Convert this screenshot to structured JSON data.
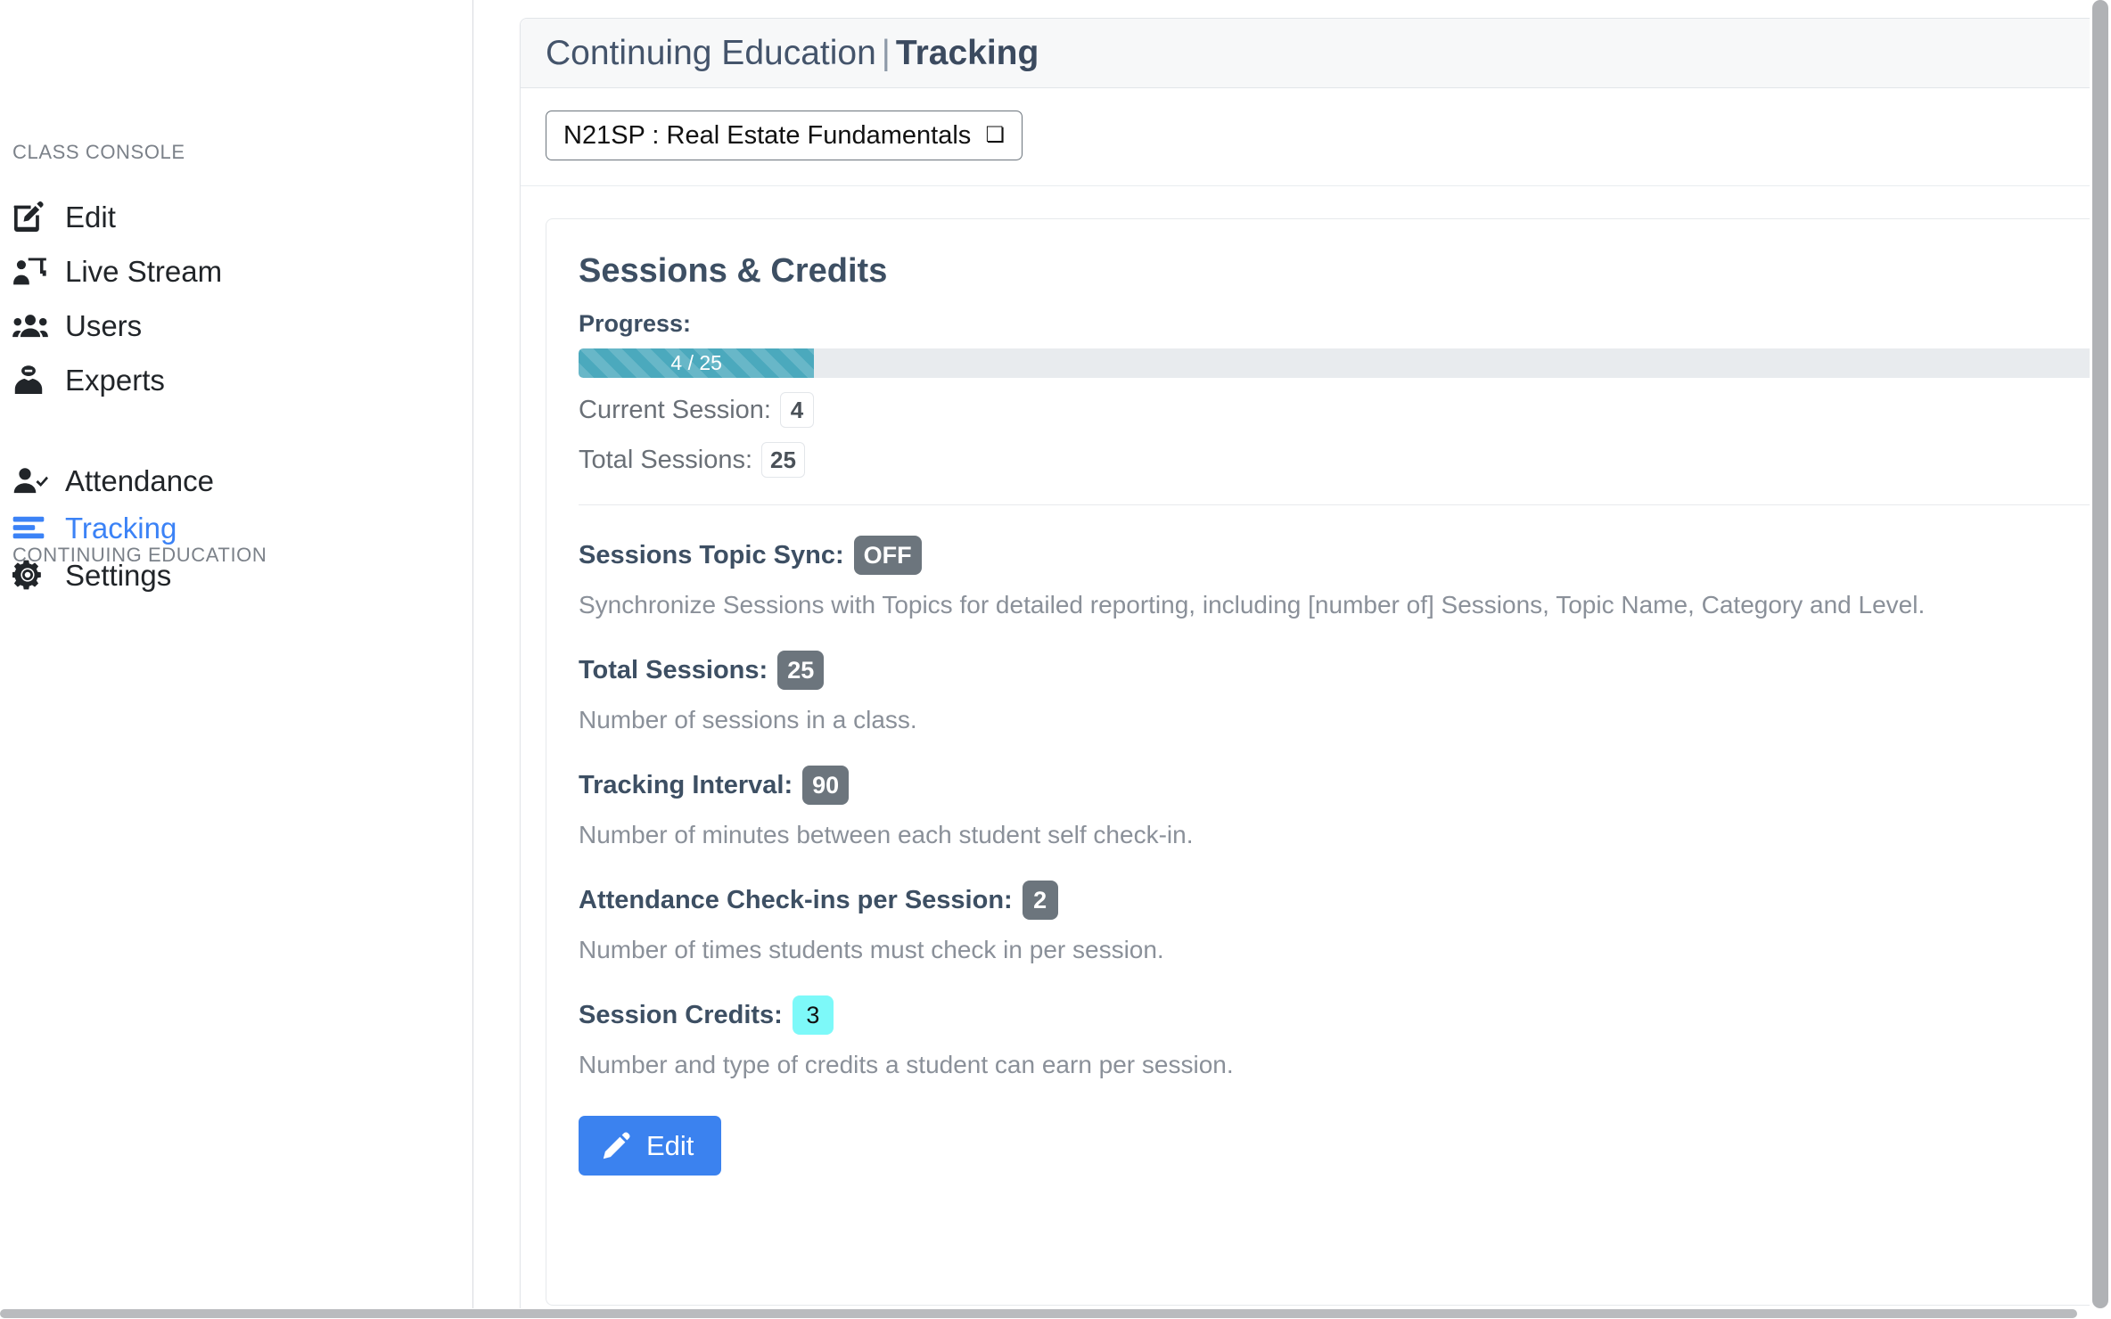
{
  "sidebar": {
    "sections": [
      {
        "label": "CLASS CONSOLE"
      },
      {
        "label": "CONTINUING EDUCATION"
      }
    ],
    "items": [
      {
        "label": "Edit",
        "icon": "edit-square-icon",
        "active": false
      },
      {
        "label": "Live Stream",
        "icon": "chalkboard-user-icon",
        "active": false
      },
      {
        "label": "Users",
        "icon": "users-group-icon",
        "active": false
      },
      {
        "label": "Experts",
        "icon": "user-tie-icon",
        "active": false
      },
      {
        "label": "Attendance",
        "icon": "user-check-icon",
        "active": false
      },
      {
        "label": "Tracking",
        "icon": "align-left-bars-icon",
        "active": true
      },
      {
        "label": "Settings",
        "icon": "gear-icon",
        "active": false
      }
    ],
    "active_color": "#3b82f6"
  },
  "header": {
    "breadcrumb_primary": "Continuing Education",
    "breadcrumb_separator": "|",
    "breadcrumb_current": "Tracking"
  },
  "class_selector": {
    "selected": "N21SP : Real Estate Fundamentals",
    "caret": "chevron-down-icon",
    "options": [
      "N21SP : Real Estate Fundamentals"
    ]
  },
  "panel": {
    "title": "Sessions & Credits",
    "progress": {
      "label": "Progress:",
      "text": "4 / 25",
      "current": 4,
      "total": 25,
      "percent": 16,
      "fill_color": "#4ba9bd",
      "track_color": "#e8ebee"
    },
    "summary": [
      {
        "label": "Current Session:",
        "value": "4"
      },
      {
        "label": "Total Sessions:",
        "value": "25"
      }
    ],
    "settings": [
      {
        "label": "Sessions Topic Sync:",
        "value": "OFF",
        "highlight": false,
        "description": "Synchronize Sessions with Topics for detailed reporting, including [number of] Sessions, Topic Name, Category and Level."
      },
      {
        "label": "Total Sessions:",
        "value": "25",
        "highlight": false,
        "description": "Number of sessions in a class."
      },
      {
        "label": "Tracking Interval:",
        "value": "90",
        "highlight": false,
        "description": "Number of minutes between each student self check-in."
      },
      {
        "label": "Attendance Check-ins per Session:",
        "value": "2",
        "highlight": false,
        "description": "Number of times students must check in per session."
      },
      {
        "label": "Session Credits:",
        "value": "3",
        "highlight": true,
        "highlight_color": "#7df9f9",
        "description": "Number and type of credits a student can earn per session."
      }
    ],
    "edit_button": {
      "label": "Edit",
      "icon": "pencil-icon",
      "color": "#3b82ef"
    }
  }
}
